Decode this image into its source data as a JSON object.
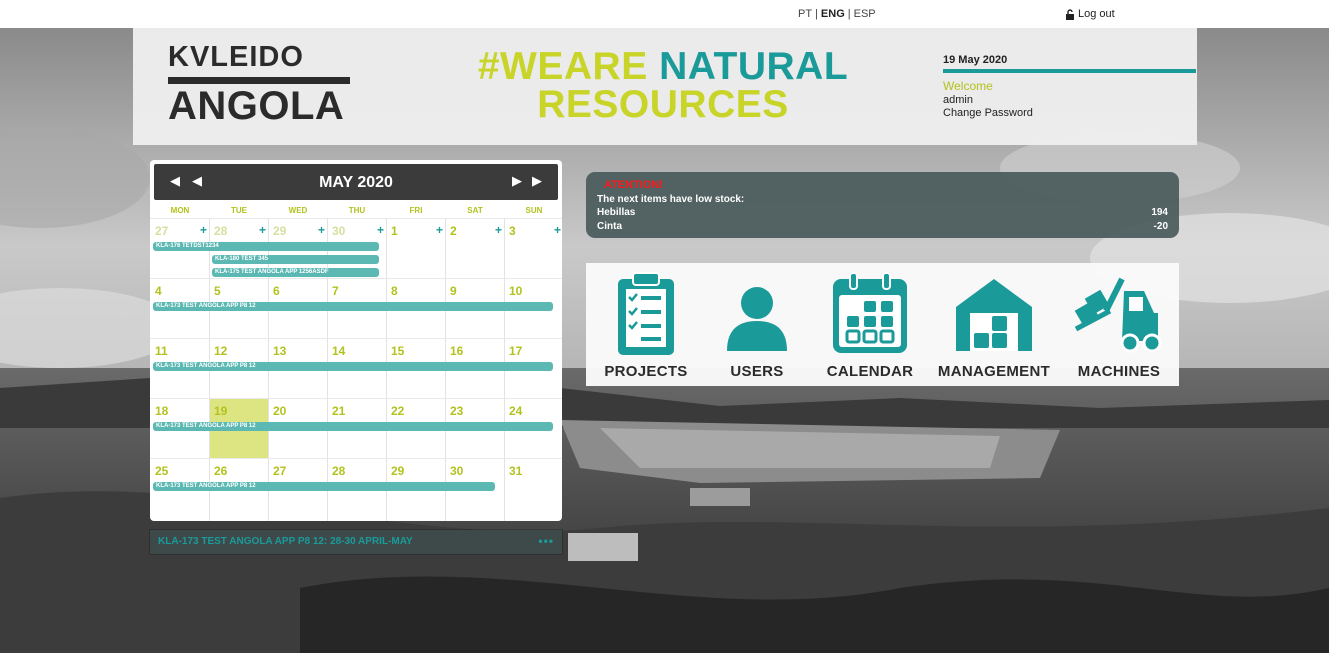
{
  "topbar": {
    "languages": [
      "PT",
      "ENG",
      "ESP"
    ],
    "active_language": "ENG",
    "logout_label": "Log out"
  },
  "header": {
    "logo_line1": "KVLEIDO",
    "logo_line2": "ANGOLA",
    "slogan_part1": "#WEARE",
    "slogan_part2": "NATURAL",
    "slogan_part3": "RESOURCES",
    "date": "19 May 2020",
    "welcome": "Welcome",
    "username": "admin",
    "change_password": "Change Password"
  },
  "calendar": {
    "title": "MAY 2020",
    "weekdays": [
      "MON",
      "TUE",
      "WED",
      "THU",
      "FRI",
      "SAT",
      "SUN"
    ],
    "weeks": [
      [
        "27",
        "28",
        "29",
        "30",
        "1",
        "2",
        "3"
      ],
      [
        "4",
        "5",
        "6",
        "7",
        "8",
        "9",
        "10"
      ],
      [
        "11",
        "12",
        "13",
        "14",
        "15",
        "16",
        "17"
      ],
      [
        "18",
        "19",
        "20",
        "21",
        "22",
        "23",
        "24"
      ],
      [
        "25",
        "26",
        "27",
        "28",
        "29",
        "30",
        "31"
      ]
    ],
    "events": [
      {
        "label": "KLA-176 TETDST1234"
      },
      {
        "label": "KLA-180 TEST 345"
      },
      {
        "label": "KLA-175 TEST ANGOLA APP 1256ASDF"
      },
      {
        "label": "KLA-173 TEST ANGOLA APP P8 12"
      },
      {
        "label": "KLA-173 TEST ANGOLA APP P8 12"
      },
      {
        "label": "KLA-173 TEST ANGOLA APP P8 12"
      },
      {
        "label": "KLA-173 TEST ANGOLA APP P8 12"
      }
    ],
    "selected_event": "KLA-173 TEST ANGOLA APP P8 12: 28-30 APRIL-MAY",
    "more_label": "•••",
    "colors": {
      "accent": "#1b9a9a",
      "day": "#b3c21e",
      "event": "#5cb8b3",
      "today": "#dde582"
    }
  },
  "attention": {
    "heading": "ATENTION!",
    "message": "The next items have low stock:",
    "items": [
      {
        "name": "Hebillas",
        "value": "194"
      },
      {
        "name": "Cinta",
        "value": "-20"
      }
    ]
  },
  "menu": {
    "items": [
      {
        "label": "PROJECTS",
        "icon": "clipboard-checklist-icon"
      },
      {
        "label": "USERS",
        "icon": "user-icon"
      },
      {
        "label": "CALENDAR",
        "icon": "calendar-icon"
      },
      {
        "label": "MANAGEMENT",
        "icon": "warehouse-icon"
      },
      {
        "label": "MACHINES",
        "icon": "forklift-icon"
      }
    ]
  }
}
